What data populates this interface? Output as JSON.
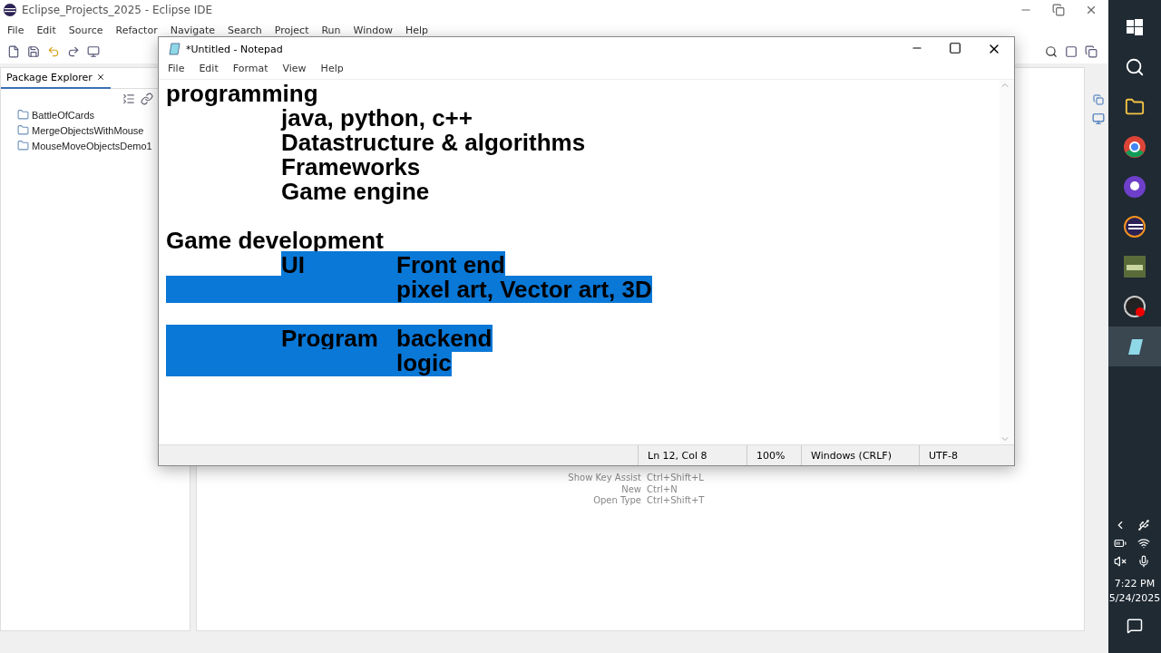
{
  "window": {
    "title": "Eclipse_Projects_2025 - Eclipse IDE"
  },
  "menu": [
    "File",
    "Edit",
    "Source",
    "Refactor",
    "Navigate",
    "Search",
    "Project",
    "Run",
    "Window",
    "Help"
  ],
  "package_explorer": {
    "title": "Package Explorer",
    "projects": [
      {
        "name": "BattleOfCards"
      },
      {
        "name": "MergeObjectsWithMouse"
      },
      {
        "name": "MouseMoveObjectsDemo1"
      }
    ]
  },
  "key_assist": [
    {
      "action": "Show Key Assist",
      "keys": "Ctrl+Shift+L"
    },
    {
      "action": "New",
      "keys": "Ctrl+N"
    },
    {
      "action": "Open Type",
      "keys": "Ctrl+Shift+T"
    }
  ],
  "notepad": {
    "title": "*Untitled - Notepad",
    "menu": [
      "File",
      "Edit",
      "Format",
      "View",
      "Help"
    ],
    "lines": [
      {
        "kind": "plain",
        "segments": [
          {
            "text": "programming",
            "selected": false
          }
        ]
      },
      {
        "kind": "indented",
        "segments": [
          {
            "text": "java, python, c++",
            "selected": false
          }
        ]
      },
      {
        "kind": "indented",
        "segments": [
          {
            "text": "Datastructure & algorithms",
            "selected": false
          }
        ]
      },
      {
        "kind": "indented",
        "segments": [
          {
            "text": "Frameworks",
            "selected": false
          }
        ]
      },
      {
        "kind": "indented",
        "segments": [
          {
            "text": "Game engine",
            "selected": false
          }
        ]
      },
      {
        "kind": "blank"
      },
      {
        "kind": "plain",
        "segments": [
          {
            "text": "Game development",
            "selected": false
          }
        ]
      },
      {
        "kind": "indented",
        "segments": [
          {
            "text": "UI\tFront end",
            "selected": true
          }
        ]
      },
      {
        "kind": "plain",
        "segments": [
          {
            "text": "\t\tpixel art, Vector art, 3D",
            "selected": true
          }
        ]
      },
      {
        "kind": "blank"
      },
      {
        "kind": "plain",
        "segments": [
          {
            "text": "\tProgram\tbackend",
            "selected": true
          }
        ]
      },
      {
        "kind": "plain",
        "segments": [
          {
            "text": "\t\tlogic",
            "selected": true
          }
        ]
      }
    ],
    "status": [
      "Ln 12, Col 8",
      "100%",
      "Windows (CRLF)",
      "UTF-8"
    ]
  },
  "taskbar": {
    "time": "7:22 PM",
    "date": "5/24/2025"
  }
}
